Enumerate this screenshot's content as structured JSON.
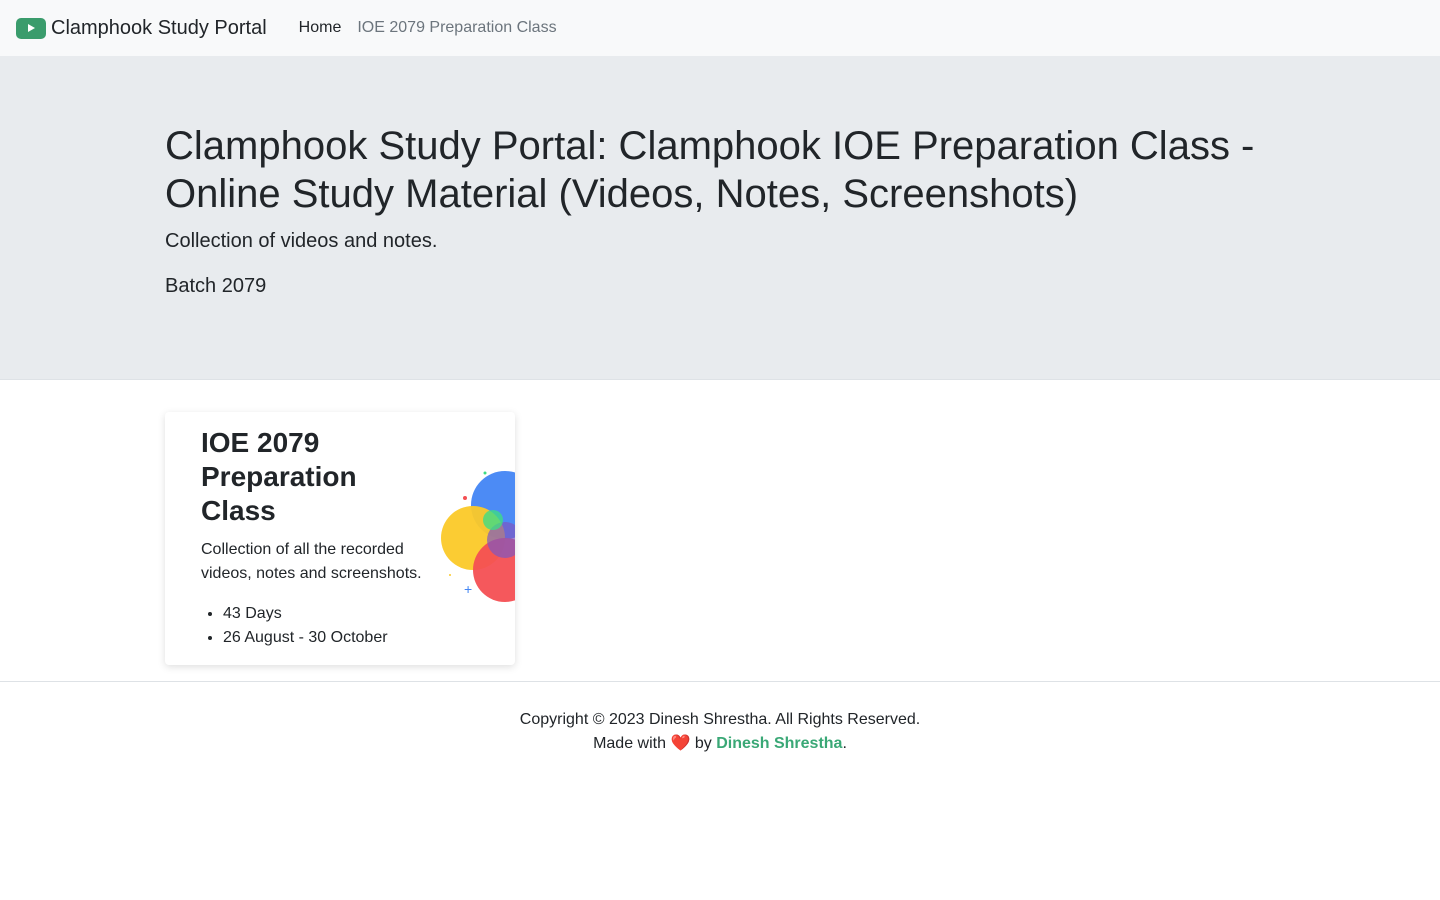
{
  "navbar": {
    "brand": "Clamphook Study Portal",
    "links": [
      {
        "label": "Home",
        "active": true
      },
      {
        "label": "IOE 2079 Preparation Class",
        "active": false
      }
    ]
  },
  "hero": {
    "title": "Clamphook Study Portal: Clamphook IOE Preparation Class - Online Study Material (Videos, Notes, Screenshots)",
    "subtitle": "Collection of videos and notes.",
    "batch": "Batch 2079"
  },
  "card": {
    "title": "IOE 2079 Preparation Class",
    "description": "Collection of all the recorded videos, notes and screenshots.",
    "items": [
      "43 Days",
      "26 August - 30 October"
    ]
  },
  "footer": {
    "copyright": "Copyright © 2023 Dinesh Shrestha. All Rights Reserved.",
    "made_with_prefix": "Made with",
    "heart": "❤️",
    "by": "by",
    "author": "Dinesh Shrestha",
    "suffix": "."
  },
  "colors": {
    "brand_green": "#3a9c6c",
    "link_green": "#3aa876",
    "hero_bg": "#e8ebee",
    "navbar_bg": "#f8f9fa"
  }
}
